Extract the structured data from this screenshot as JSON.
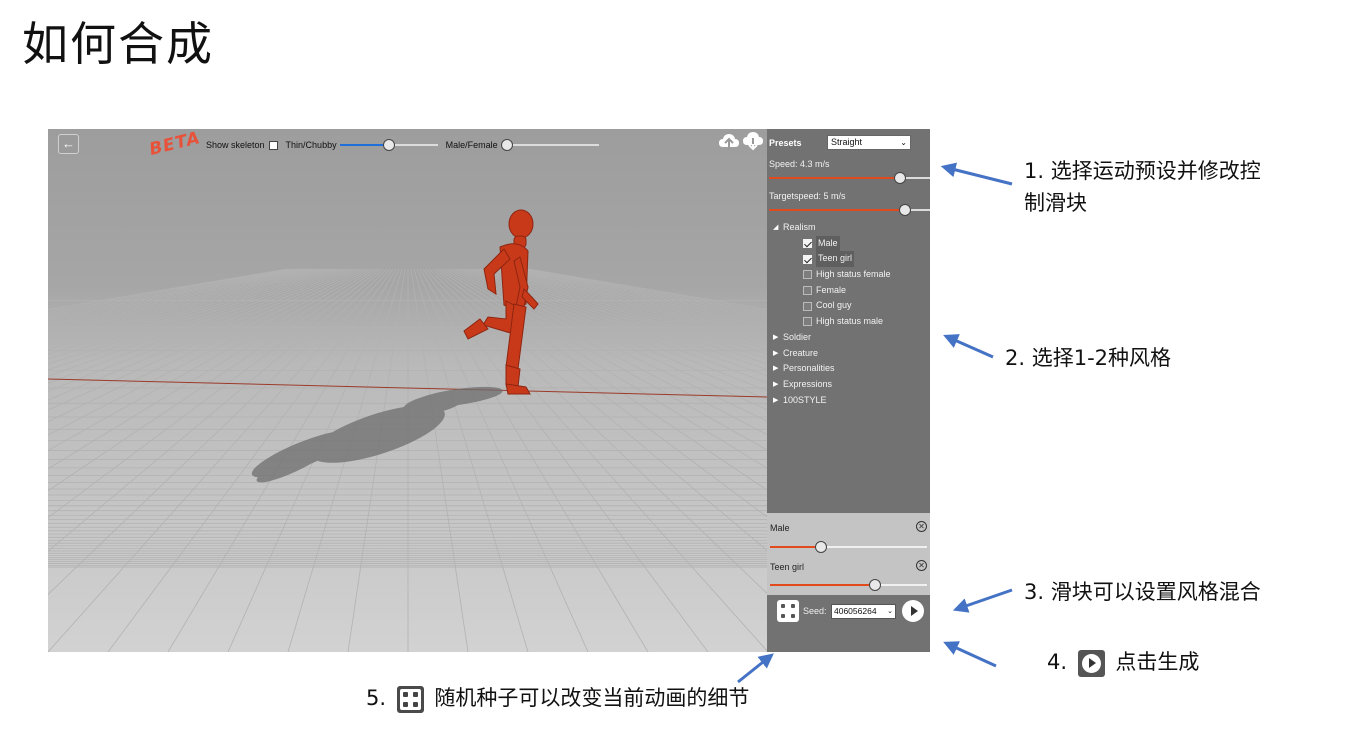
{
  "slide": {
    "title": "如何合成"
  },
  "app": {
    "beta_label": "BETA",
    "topbar": {
      "show_skeleton_label": "Show skeleton",
      "show_skeleton_checked": false,
      "thin_chubby_label": "Thin/Chubby",
      "thin_chubby_value": 0.5,
      "male_female_label": "Male/Female",
      "male_female_value": 0.0
    },
    "icons": {
      "back": "arrow-left-icon",
      "upload": "cloud-upload-icon",
      "download": "cloud-download-icon"
    },
    "panel": {
      "presets_label": "Presets",
      "presets_selected": "Straight",
      "speed_label": "Speed:  4.3  m/s",
      "speed_value": 0.84,
      "targetspeed_label": "Targetspeed:  5  m/s",
      "targetspeed_value": 0.87,
      "styles": [
        {
          "name": "Realism",
          "expanded": true,
          "children": [
            {
              "name": "Male",
              "checked": true
            },
            {
              "name": "Teen girl",
              "checked": true
            },
            {
              "name": "High status female",
              "checked": false
            },
            {
              "name": "Female",
              "checked": false
            },
            {
              "name": "Cool guy",
              "checked": false
            },
            {
              "name": "High status male",
              "checked": false
            }
          ]
        },
        {
          "name": "Soldier",
          "expanded": false
        },
        {
          "name": "Creature",
          "expanded": false
        },
        {
          "name": "Personalities",
          "expanded": false
        },
        {
          "name": "Expressions",
          "expanded": false
        },
        {
          "name": "100STYLE",
          "expanded": false
        }
      ],
      "mix": [
        {
          "name": "Male",
          "value": 0.31
        },
        {
          "name": "Teen girl",
          "value": 0.68
        }
      ],
      "seed_label": "Seed:",
      "seed_value": "406056264"
    }
  },
  "annotations": {
    "a1": "1. 选择运动预设并修改控制滑块",
    "a1_line1": "1. 选择运动预设并修改控",
    "a1_line2": "制滑块",
    "a2": "2. 选择1-2种风格",
    "a3": "3. 滑块可以设置风格混合",
    "a4_prefix": "4.",
    "a4_text": "点击生成",
    "a5_prefix": "5.",
    "a5_text": "随机种子可以改变当前动画的细节"
  },
  "colors": {
    "accent_orange": "#e04a1c",
    "accent_blue": "#1e6fd9",
    "arrow_blue": "#4472c4",
    "panel_bg": "#727272"
  }
}
